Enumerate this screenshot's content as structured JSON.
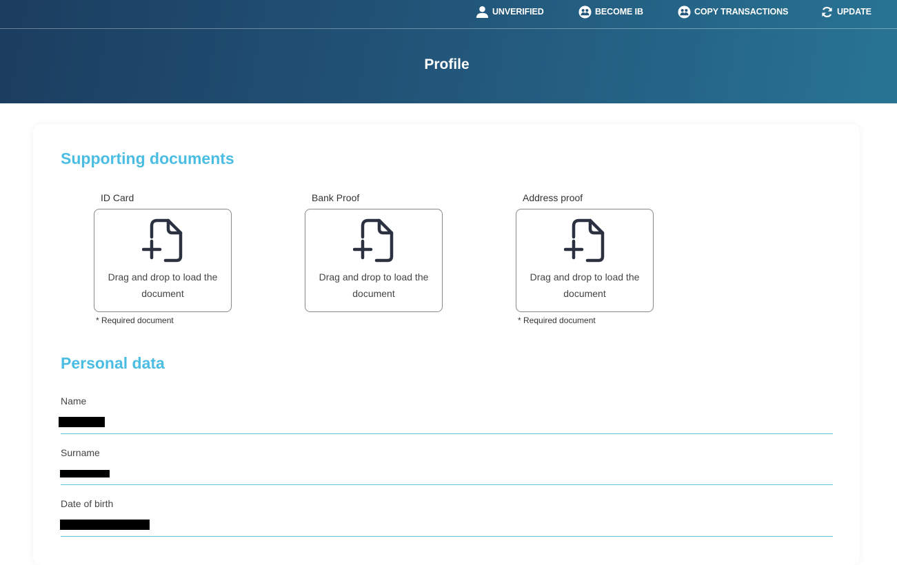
{
  "nav": {
    "unverified": "UNVERIFIED",
    "become_ib": "BECOME IB",
    "copy_transactions": "COPY TRANSACTIONS",
    "update": "UPDATE"
  },
  "header": {
    "title": "Profile"
  },
  "documents": {
    "title": "Supporting documents",
    "items": [
      {
        "label": "ID Card",
        "text": "Drag and drop to load the document",
        "required": "* Required document"
      },
      {
        "label": "Bank Proof",
        "text": "Drag and drop to load the document"
      },
      {
        "label": "Address proof",
        "text": "Drag and drop to load the document",
        "required": "* Required document"
      }
    ]
  },
  "personal": {
    "title": "Personal data",
    "fields": [
      {
        "label": "Name",
        "value": ""
      },
      {
        "label": "Surname",
        "value": ""
      },
      {
        "label": "Date of birth",
        "value": ""
      }
    ]
  },
  "colors": {
    "accent": "#4bbde3",
    "header_start": "#1b3d5f",
    "header_end": "#287494",
    "field_underline": "#5fc3e0"
  },
  "icons": {
    "unverified": "user-icon",
    "become_ib": "handshake-icon",
    "copy_transactions": "handshake-icon",
    "update": "refresh-icon",
    "upload": "file-plus-icon"
  }
}
